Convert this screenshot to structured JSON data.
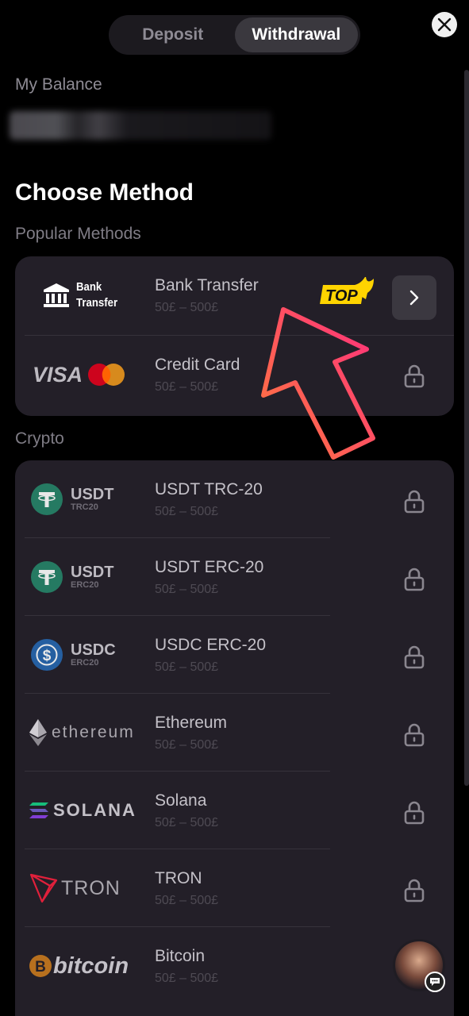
{
  "tabs": {
    "deposit": "Deposit",
    "withdrawal": "Withdrawal",
    "active": "withdrawal"
  },
  "balance": {
    "label": "My Balance"
  },
  "title": "Choose Method",
  "popular": {
    "label": "Popular Methods",
    "bank": {
      "logo_line1": "Bank",
      "logo_line2": "Transfer",
      "name": "Bank Transfer",
      "limit": "50£ – 500£",
      "badge": "TOP"
    },
    "card": {
      "visa": "VISA",
      "name": "Credit Card",
      "limit": "50£ – 500£"
    }
  },
  "crypto": {
    "label": "Crypto",
    "items": [
      {
        "ticker": "USDT",
        "sub": "TRC20",
        "name": "USDT TRC-20",
        "limit": "50£ – 500£"
      },
      {
        "ticker": "USDT",
        "sub": "ERC20",
        "name": "USDT ERC-20",
        "limit": "50£ – 500£"
      },
      {
        "ticker": "USDC",
        "sub": "ERC20",
        "name": "USDC ERC-20",
        "limit": "50£ – 500£"
      },
      {
        "wordmark": "ethereum",
        "name": "Ethereum",
        "limit": "50£ – 500£"
      },
      {
        "wordmark": "SOLANA",
        "name": "Solana",
        "limit": "50£ – 500£"
      },
      {
        "wordmark": "TRON",
        "name": "TRON",
        "limit": "50£ – 500£"
      },
      {
        "wordmark": "bitcoin",
        "name": "Bitcoin",
        "limit": "50£ – 500£"
      }
    ]
  },
  "colors": {
    "background": "#000000",
    "card": "#231f28",
    "tether": "#26a17b",
    "usdc": "#2775ca",
    "tron": "#e0203b",
    "bitcoin": "#f7931a",
    "badge": "#ffd400",
    "arrow_start": "#ff7a3c",
    "arrow_end": "#ff2f7e"
  }
}
